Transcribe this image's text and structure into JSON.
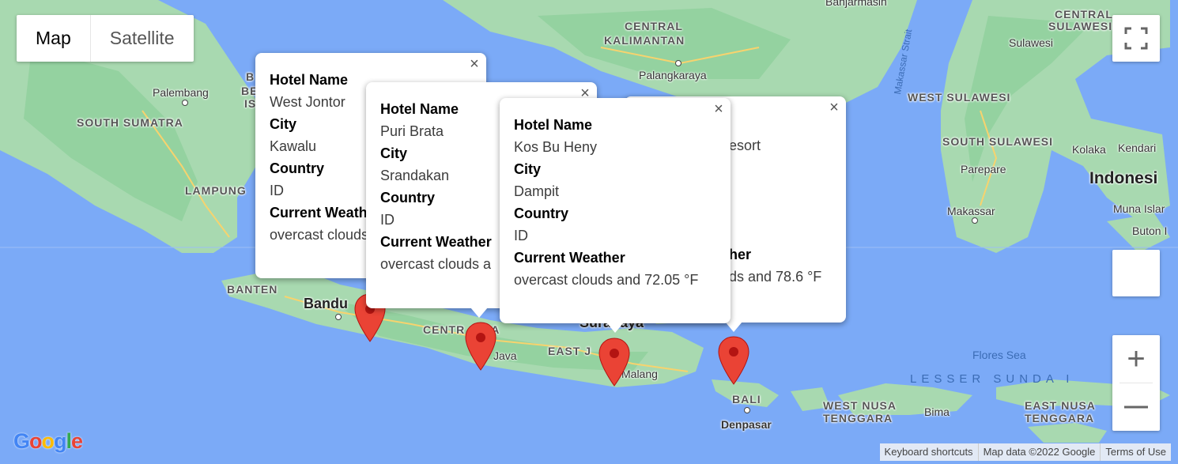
{
  "map_type": {
    "map_label": "Map",
    "satellite_label": "Satellite",
    "selected": "Map"
  },
  "controls": {
    "fullscreen_icon": "fullscreen-icon",
    "zoom_in_icon": "plus-icon",
    "zoom_out_icon": "minus-icon",
    "zoom_in_symbol": "+",
    "zoom_out_symbol": "—"
  },
  "labels": {
    "central_kalimantan_1": "CENTRAL",
    "central_kalimantan_2": "KALIMANTAN",
    "palangkaraya": "Palangkaraya",
    "central_sulawesi_1": "CENTRAL",
    "central_sulawesi_2": "SULAWESI",
    "sulawesi": "Sulawesi",
    "makassar_strait": "Makassar Strait",
    "west_sulawesi": "WEST SULAWESI",
    "south_sulawesi": "SOUTH SULAWESI",
    "parepare": "Parepare",
    "kolaka": "Kolaka",
    "kendari": "Kendari",
    "indonesia": "Indonesi",
    "makassar": "Makassar",
    "muna_island": "Muna Islar",
    "buton": "Buton I",
    "palembang": "Palembang",
    "south_sumatra": "SOUTH SUMATRA",
    "lampung": "LAMPUNG",
    "banten": "BANTEN",
    "bandung": "Bandu",
    "central_java": "CENTR   JAVA",
    "java": "Java",
    "east_java": "EAST J",
    "surabaya": "Surabaya",
    "malang": "Malang",
    "bali": "BALI",
    "denpasar": "Denpasar",
    "flores_sea": "Flores Sea",
    "lesser_sunda": "LESSER SUNDA I",
    "west_nusa_tenggara_1": "WEST NUSA",
    "west_nusa_tenggara_2": "TENGGARA",
    "bima": "Bima",
    "east_nusa_tenggara_1": "EAST NUSA",
    "east_nusa_tenggara_2": "TENGGARA",
    "partial_b": "B",
    "partial_be": "BE",
    "partial_is": "IS",
    "banjarmasin": "Banjarmasin"
  },
  "info_windows": [
    {
      "hotel_label": "Hotel Name",
      "hotel": "West Jontor",
      "city_label": "City",
      "city": "Kawalu",
      "country_label": "Country",
      "country": "ID",
      "weather_label": "Current Weather",
      "weather": "overcast clouds"
    },
    {
      "hotel_label": "Hotel Name",
      "hotel": "Puri Brata",
      "city_label": "City",
      "city": "Srandakan",
      "country_label": "Country",
      "country": "ID",
      "weather_label": "Current Weather",
      "weather": "overcast clouds a"
    },
    {
      "hotel_label": "Hotel Name",
      "hotel": "Kos Bu Heny",
      "city_label": "City",
      "city": "Dampit",
      "country_label": "Country",
      "country": "ID",
      "weather_label": "Current Weather",
      "weather": "overcast clouds and 72.05 °F"
    },
    {
      "hotel_fragment": "esort",
      "weather_label_fragment": "her",
      "weather_fragment": "ds and 78.6 °F"
    }
  ],
  "close_symbol": "×",
  "footer": {
    "shortcuts": "Keyboard shortcuts",
    "map_data": "Map data ©2022 Google",
    "terms": "Terms of Use"
  },
  "logo": {
    "text": "Google",
    "colors": [
      "#4285F4",
      "#EA4335",
      "#FBBC05",
      "#4285F4",
      "#34A853",
      "#EA4335"
    ]
  },
  "colors": {
    "water": "#7baaf7",
    "land": "#a8d9b0",
    "forest": "#94d2a0",
    "road": "#f7d36e",
    "marker": "#ea4335"
  }
}
